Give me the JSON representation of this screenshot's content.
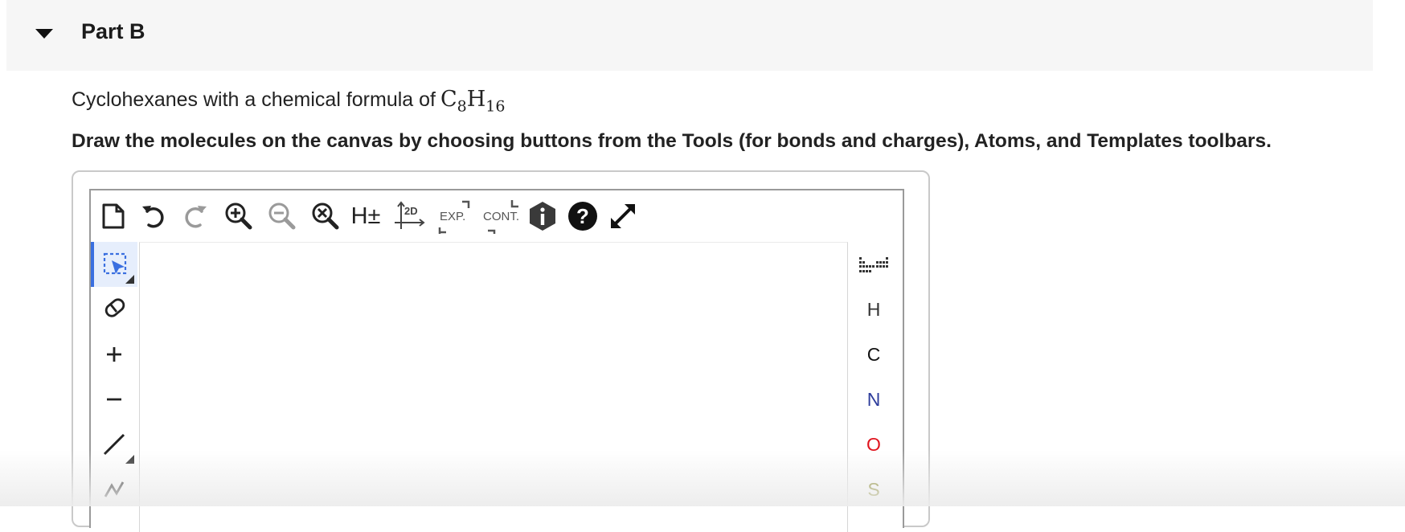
{
  "part": {
    "title": "Part B"
  },
  "question": {
    "prompt": "Cyclohexanes with a chemical formula of",
    "formula": {
      "c": "C",
      "c_sub": "8",
      "h": "H",
      "h_sub": "16"
    },
    "instruction": "Draw the molecules on the canvas by choosing buttons from the Tools (for bonds and charges), Atoms, and Templates toolbars."
  },
  "toolbar": {
    "hydrogen_label": "H±",
    "layout_label": "2D",
    "expand_label": "EXP.",
    "contract_label": "CONT."
  },
  "atoms": [
    {
      "symbol": "H",
      "color": "#333333"
    },
    {
      "symbol": "C",
      "color": "#111111"
    },
    {
      "symbol": "N",
      "color": "#2e3d9c"
    },
    {
      "symbol": "O",
      "color": "#e0141e"
    },
    {
      "symbol": "S",
      "color": "#7a7a10"
    }
  ],
  "colors": {
    "accent": "#3a6fe0",
    "header_bg": "#f6f6f6"
  }
}
